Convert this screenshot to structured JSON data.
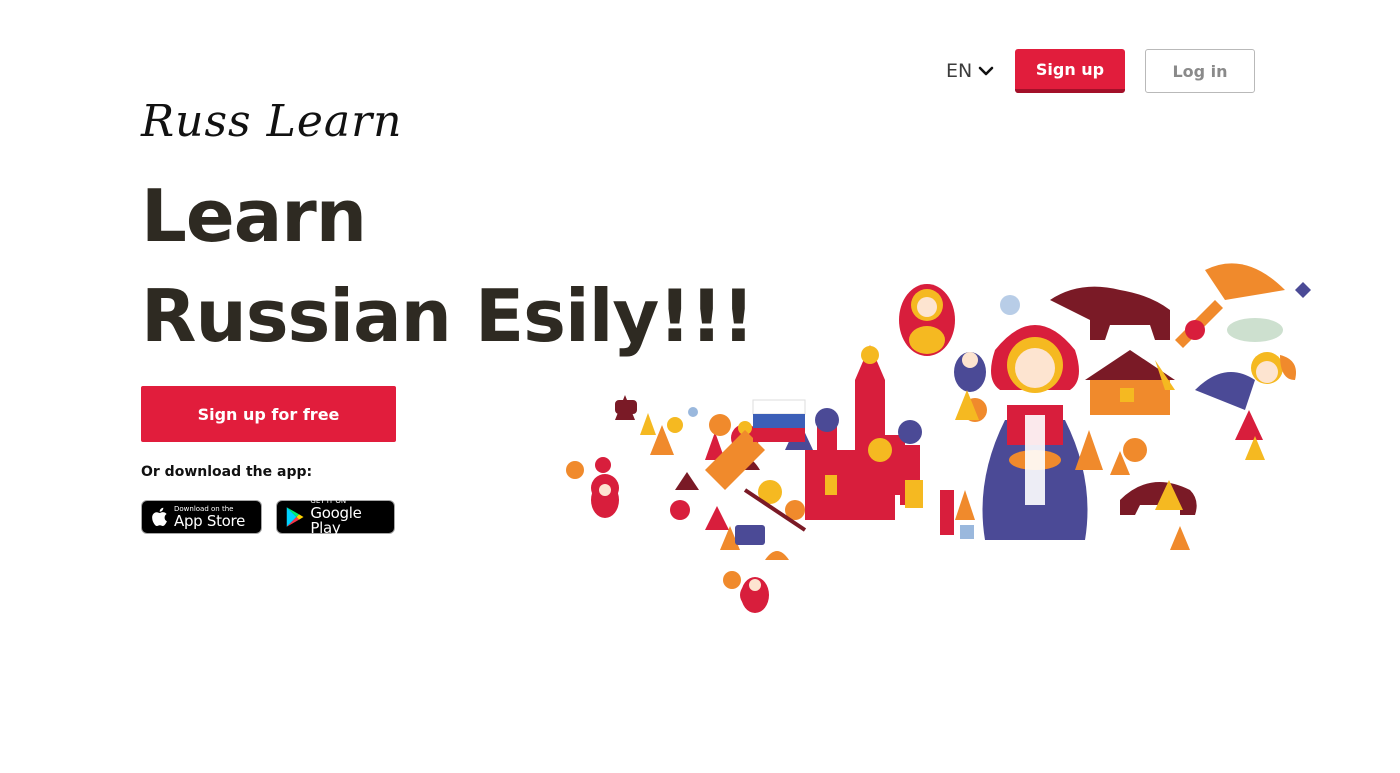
{
  "header": {
    "language": "EN",
    "signup_label": "Sign up",
    "login_label": "Log in"
  },
  "logo": {
    "text": "Russ Learn"
  },
  "hero": {
    "title_line1": "Learn",
    "title_line2": "Russian Esily!!!",
    "cta_label": "Sign up for free",
    "download_label": "Or download the app:"
  },
  "badges": {
    "apple": {
      "small": "Download on the",
      "big": "App Store"
    },
    "google": {
      "small": "GET IT ON",
      "big": "Google Play"
    }
  },
  "colors": {
    "accent": "#e11d3c",
    "accent_dark": "#a31029",
    "title": "#2e2a22",
    "map_red": "#d81e3c",
    "map_brown": "#7a1a26",
    "map_orange": "#f08a2c",
    "map_yellow": "#f5b921",
    "map_blue": "#4b4a96",
    "map_lightblue": "#9ab8dd"
  },
  "icons": {
    "language_chevron": "chevron-down-icon",
    "apple": "apple-icon",
    "google_play": "google-play-icon"
  }
}
